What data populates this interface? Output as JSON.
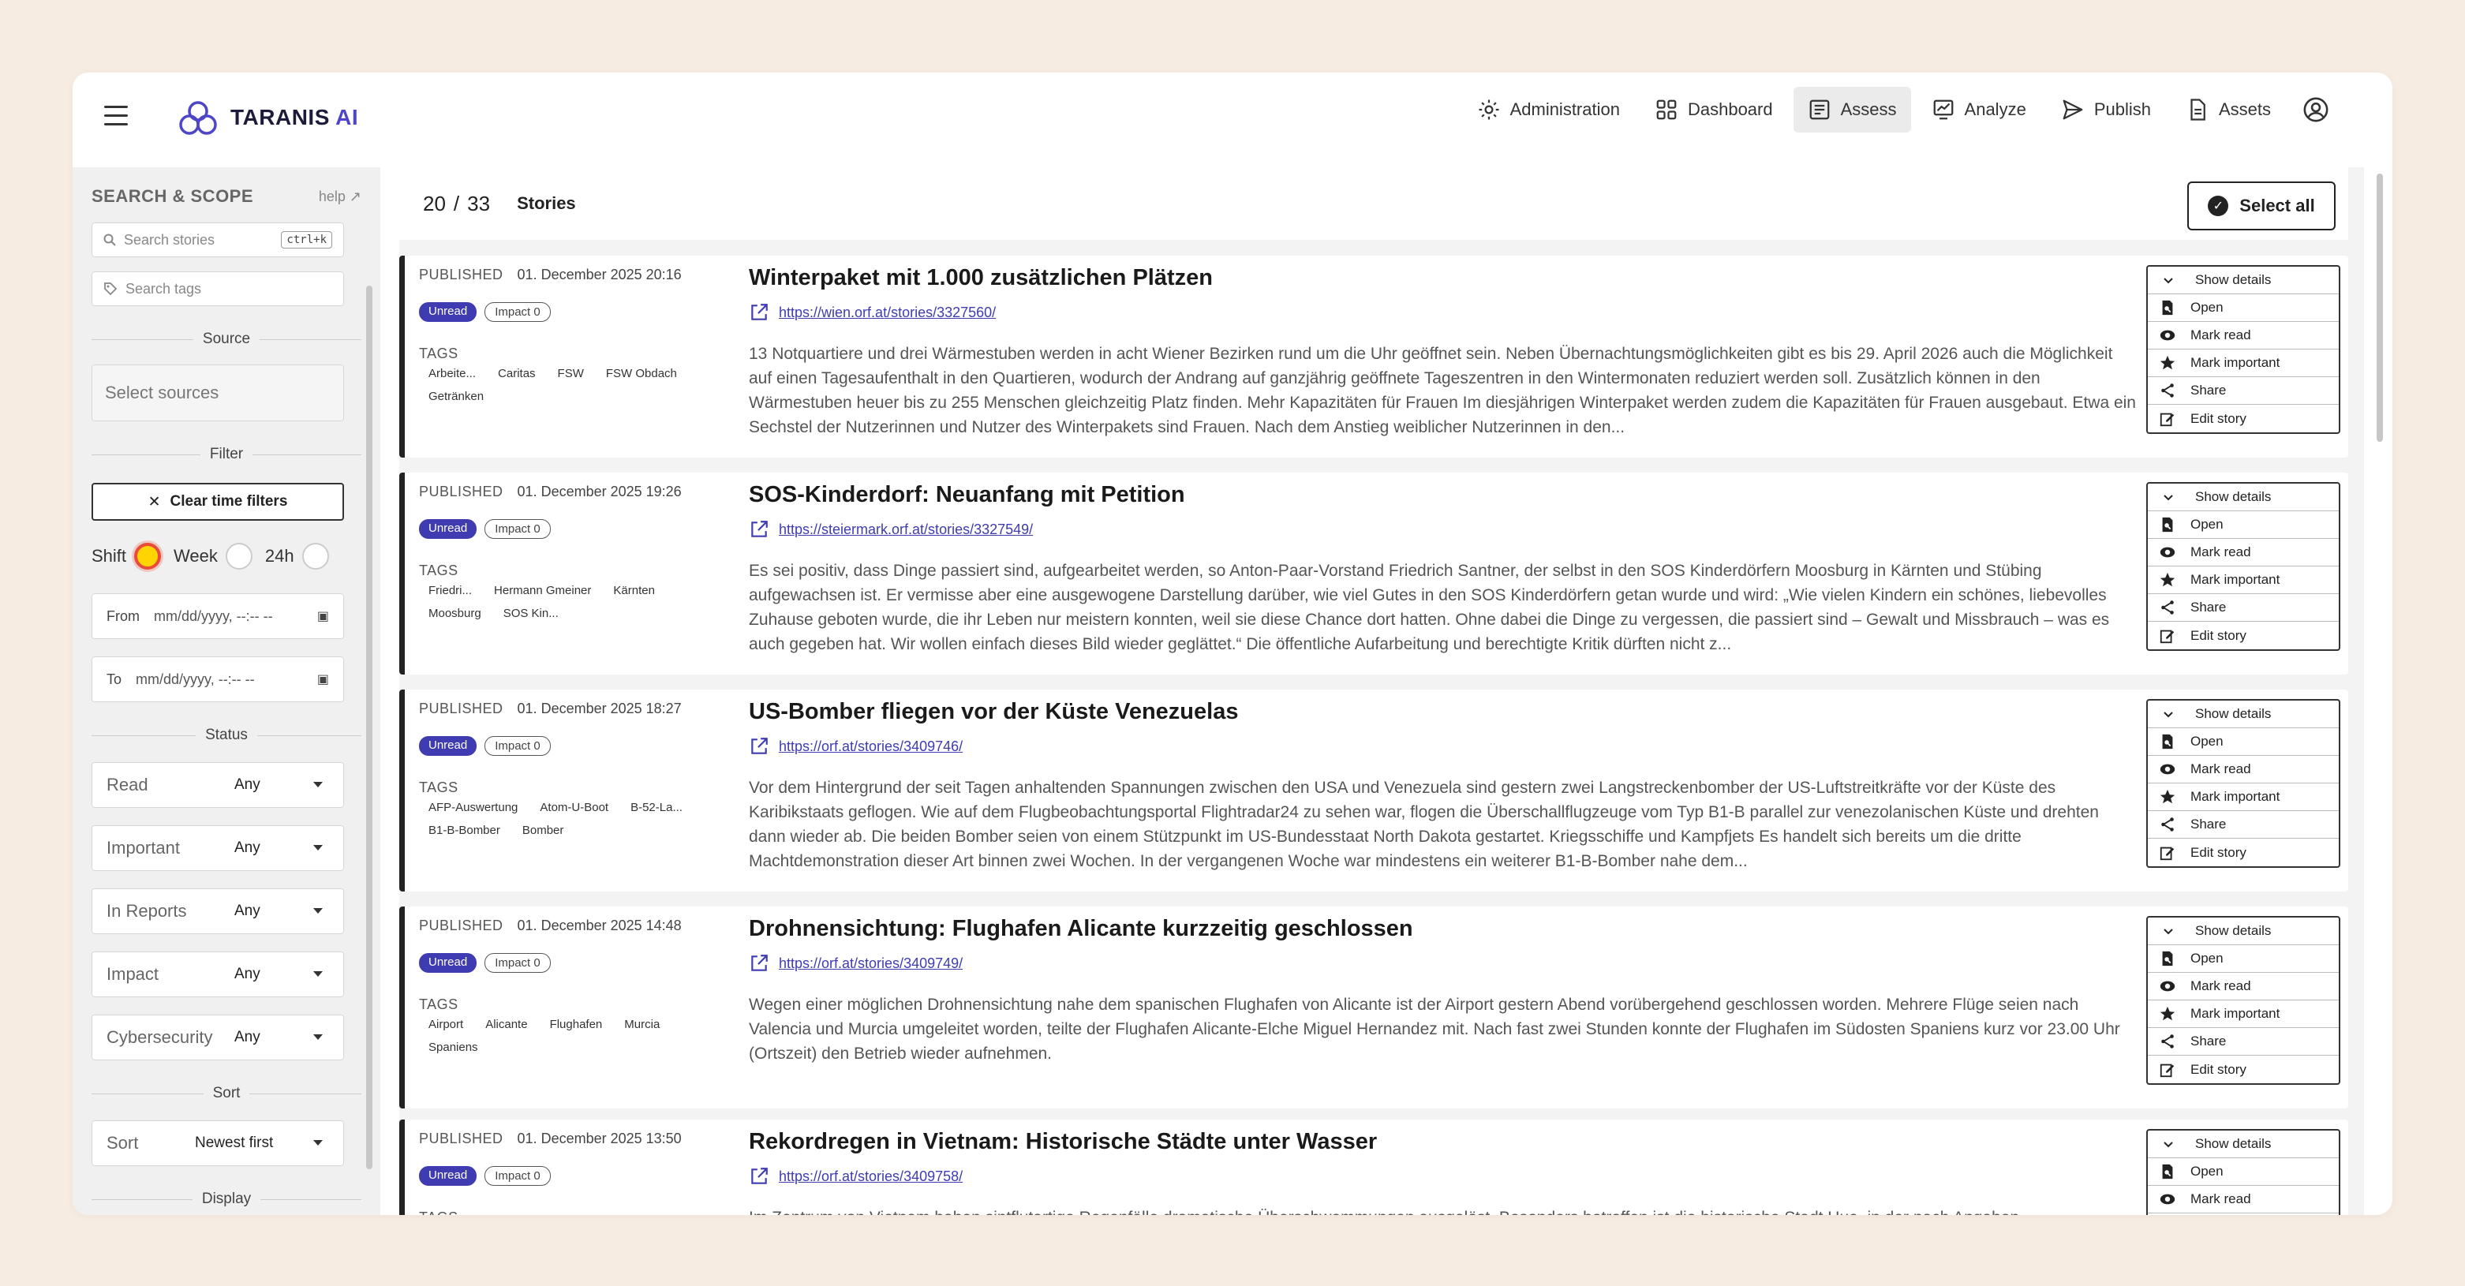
{
  "app": {
    "logo_main": "TARANIS",
    "logo_ai": "AI"
  },
  "nav": [
    {
      "label": "Administration",
      "icon": "gear-icon",
      "active": false
    },
    {
      "label": "Dashboard",
      "icon": "dashboard-icon",
      "active": false
    },
    {
      "label": "Assess",
      "icon": "assess-icon",
      "active": true
    },
    {
      "label": "Analyze",
      "icon": "analyze-icon",
      "active": false
    },
    {
      "label": "Publish",
      "icon": "send-icon",
      "active": false
    },
    {
      "label": "Assets",
      "icon": "document-icon",
      "active": false
    }
  ],
  "sidebar": {
    "title": "SEARCH & SCOPE",
    "help": "help",
    "search_placeholder": "Search stories",
    "search_shortcut": "ctrl+k",
    "tags_placeholder": "Search tags",
    "source_section": "Source",
    "select_sources": "Select sources",
    "filter_section": "Filter",
    "clear_time_filters": "Clear time filters",
    "range_shift": "Shift",
    "range_week": "Week",
    "range_24h": "24h",
    "from_label": "From",
    "to_label": "To",
    "date_placeholder": "mm/dd/yyyy, --:-- --",
    "status_section": "Status",
    "status_filters": [
      {
        "label": "Read",
        "value": "Any"
      },
      {
        "label": "Important",
        "value": "Any"
      },
      {
        "label": "In Reports",
        "value": "Any"
      },
      {
        "label": "Impact",
        "value": "Any"
      },
      {
        "label": "Cybersecurity",
        "value": "Any"
      }
    ],
    "sort_section": "Sort",
    "sort_label": "Sort",
    "sort_value": "Newest first",
    "display_section": "Display"
  },
  "stories_bar": {
    "shown": "20",
    "separator": "/",
    "total": "33",
    "label": "Stories",
    "select_all": "Select all"
  },
  "story_actions": [
    "Show details",
    "Open",
    "Mark read",
    "Mark important",
    "Share",
    "Edit story"
  ],
  "stories": [
    {
      "published_label": "PUBLISHED",
      "date": "01. December 2025 20:16",
      "status": "Unread",
      "impact": "Impact 0",
      "tags_label": "TAGS",
      "tags": [
        "Arbeite...",
        "Caritas",
        "FSW",
        "FSW Obdach",
        "Getränken"
      ],
      "title": "Winterpaket mit 1.000 zusätzlichen Plätzen",
      "url": "https://wien.orf.at/stories/3327560/",
      "body": "13 Notquartiere und drei Wärmestuben werden in acht Wiener Bezirken rund um die Uhr geöffnet sein. Neben Übernachtungsmöglichkeiten gibt es bis 29. April 2026 auch die Möglichkeit auf einen Tagesaufenthalt in den Quartieren, wodurch der Andrang auf ganzjährig geöffnete Tageszentren in den Wintermonaten reduziert werden soll. Zusätzlich können in den Wärmestuben heuer bis zu 255 Menschen gleichzeitig Platz finden. Mehr Kapazitäten für Frauen Im diesjährigen Winterpaket werden zudem die Kapazitäten für Frauen ausgebaut. Etwa ein Sechstel der Nutzerinnen und Nutzer des Winterpakets sind Frauen. Nach dem Anstieg weiblicher Nutzerinnen in den..."
    },
    {
      "published_label": "PUBLISHED",
      "date": "01. December 2025 19:26",
      "status": "Unread",
      "impact": "Impact 0",
      "tags_label": "TAGS",
      "tags": [
        "Friedri...",
        "Hermann Gmeiner",
        "Kärnten",
        "Moosburg",
        "SOS Kin..."
      ],
      "title": "SOS-Kinderdorf: Neuanfang mit Petition",
      "url": "https://steiermark.orf.at/stories/3327549/",
      "body": "Es sei positiv, dass Dinge passiert sind, aufgearbeitet werden, so Anton-Paar-Vorstand Friedrich Santner, der selbst in den SOS Kinderdörfern Moosburg in Kärnten und Stübing aufgewachsen ist. Er vermisse aber eine ausgewogene Darstellung darüber, wie viel Gutes in den SOS Kinderdörfern getan wurde und wird: „Wie vielen Kindern ein schönes, liebevolles Zuhause geboten wurde, die ihr Leben nur meistern konnten, weil sie diese Chance dort hatten. Ohne dabei die Dinge zu vergessen, die passiert sind – Gewalt und Missbrauch – was es auch gegeben hat. Wir wollen einfach dieses Bild wieder geglättet.“ Die öffentliche Aufarbeitung und berechtigte Kritik dürften nicht z..."
    },
    {
      "published_label": "PUBLISHED",
      "date": "01. December 2025 18:27",
      "status": "Unread",
      "impact": "Impact 0",
      "tags_label": "TAGS",
      "tags": [
        "AFP-Auswertung",
        "Atom-U-Boot",
        "B-52-La...",
        "B1-B-Bomber",
        "Bomber"
      ],
      "title": "US-Bomber fliegen vor der Küste Venezuelas",
      "url": "https://orf.at/stories/3409746/",
      "body": "Vor dem Hintergrund der seit Tagen anhaltenden Spannungen zwischen den USA und Venezuela sind gestern zwei Langstreckenbomber der US-Luftstreitkräfte vor der Küste des Karibikstaats geflogen. Wie auf dem Flugbeobachtungsportal Flightradar24 zu sehen war, flogen die Überschallflugzeuge vom Typ B1-B parallel zur venezolanischen Küste und drehten dann wieder ab. Die beiden Bomber seien von einem Stützpunkt im US-Bundesstaat North Dakota gestartet. Kriegsschiffe und Kampfjets Es handelt sich bereits um die dritte Machtdemonstration dieser Art binnen zwei Wochen. In der vergangenen Woche war mindestens ein weiterer B1-B-Bomber nahe dem..."
    },
    {
      "published_label": "PUBLISHED",
      "date": "01. December 2025 14:48",
      "status": "Unread",
      "impact": "Impact 0",
      "tags_label": "TAGS",
      "tags": [
        "Airport",
        "Alicante",
        "Flughafen",
        "Murcia",
        "Spaniens"
      ],
      "title": "Drohnensichtung: Flughafen Alicante kurzzeitig geschlossen",
      "url": "https://orf.at/stories/3409749/",
      "body": "Wegen einer möglichen Drohnensichtung nahe dem spanischen Flughafen von Alicante ist der Airport gestern Abend vorübergehend geschlossen worden. Mehrere Flüge seien nach Valencia und Murcia umgeleitet worden, teilte der Flughafen Alicante-Elche Miguel Hernandez mit. Nach fast zwei Stunden konnte der Flughafen im Südosten Spaniens kurz vor 23.00 Uhr (Ortszeit) den Betrieb wieder aufnehmen."
    },
    {
      "published_label": "PUBLISHED",
      "date": "01. December 2025 13:50",
      "status": "Unread",
      "impact": "Impact 0",
      "tags_label": "TAGS",
      "tags": [],
      "title": "Rekordregen in Vietnam: Historische Städte unter Wasser",
      "url": "https://orf.at/stories/3409758/",
      "body": "Im Zentrum von Vietnam haben sintflutartige Regenfälle dramatische Überschwemmungen ausgelöst. Besonders betroffen ist die historische Stadt Hue, in der nach Angaben"
    }
  ]
}
